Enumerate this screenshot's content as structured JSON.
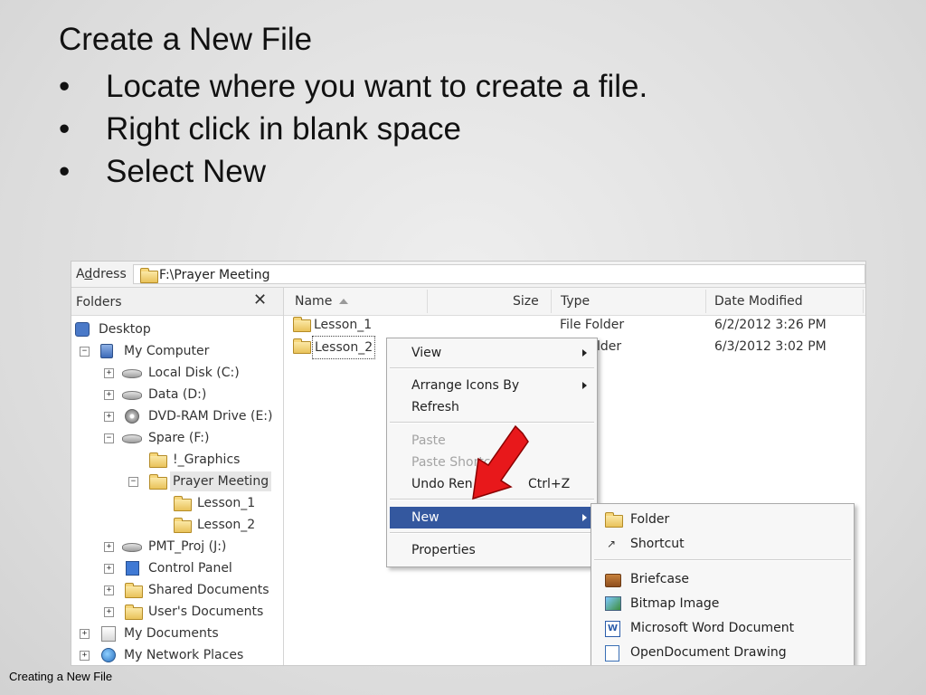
{
  "slide": {
    "title": "Create a New File",
    "bullets": [
      "Locate where you want to create a file.",
      "Right click in blank space",
      "Select New"
    ],
    "bullet_char": "•",
    "footer": "Creating a New File"
  },
  "explorer": {
    "address_label_pre": "A",
    "address_label_underline": "d",
    "address_label_post": "dress",
    "address_path": "F:\\Prayer Meeting",
    "folders_title": "Folders",
    "folders_close": "✕",
    "tree": [
      {
        "label": "Desktop",
        "icon": "desktop-icon",
        "expander": ""
      },
      {
        "label": "My Computer",
        "icon": "computer-icon",
        "expander": "−"
      },
      {
        "label": "Local Disk (C:)",
        "icon": "drive-icon",
        "expander": "+"
      },
      {
        "label": "Data (D:)",
        "icon": "drive-icon",
        "expander": "+"
      },
      {
        "label": "DVD-RAM Drive (E:)",
        "icon": "dvd-icon",
        "expander": "+"
      },
      {
        "label": "Spare (F:)",
        "icon": "drive-icon",
        "expander": "−"
      },
      {
        "label": "!_Graphics",
        "icon": "folder-icon",
        "expander": ""
      },
      {
        "label": "Prayer Meeting",
        "icon": "folder-icon",
        "expander": "−"
      },
      {
        "label": "Lesson_1",
        "icon": "folder-icon",
        "expander": ""
      },
      {
        "label": "Lesson_2",
        "icon": "folder-icon",
        "expander": ""
      },
      {
        "label": "PMT_Proj (J:)",
        "icon": "drive-icon",
        "expander": "+"
      },
      {
        "label": "Control Panel",
        "icon": "control-panel-icon",
        "expander": "+"
      },
      {
        "label": "Shared Documents",
        "icon": "folder-icon",
        "expander": "+"
      },
      {
        "label": "User's Documents",
        "icon": "folder-icon",
        "expander": "+"
      },
      {
        "label": "My Documents",
        "icon": "documents-icon",
        "expander": "+"
      },
      {
        "label": "My Network Places",
        "icon": "network-icon",
        "expander": "+"
      }
    ],
    "columns": {
      "name": "Name",
      "size": "Size",
      "type": "Type",
      "modified": "Date Modified"
    },
    "files": [
      {
        "name": "Lesson_1",
        "type": "File Folder",
        "modified": "6/2/2012 3:26 PM"
      },
      {
        "name": "Lesson_2",
        "type": "lder",
        "modified": "6/3/2012 3:02 PM"
      }
    ]
  },
  "context_menu": {
    "view": "View",
    "arrange": "Arrange Icons By",
    "refresh": "Refresh",
    "paste": "Paste",
    "paste_shortcut": "Paste Shortcu",
    "undo": "Undo Ren",
    "undo_shortcut": "Ctrl+Z",
    "new": "New",
    "properties": "Properties"
  },
  "new_submenu": {
    "folder": "Folder",
    "shortcut": "Shortcut",
    "briefcase": "Briefcase",
    "bitmap": "Bitmap Image",
    "word": "Microsoft Word Document",
    "drawing": "OpenDocument Drawing",
    "word_icon_glyph": "W"
  },
  "colors": {
    "highlight": "#34589f",
    "pointer_arrow": "#e8181b"
  }
}
